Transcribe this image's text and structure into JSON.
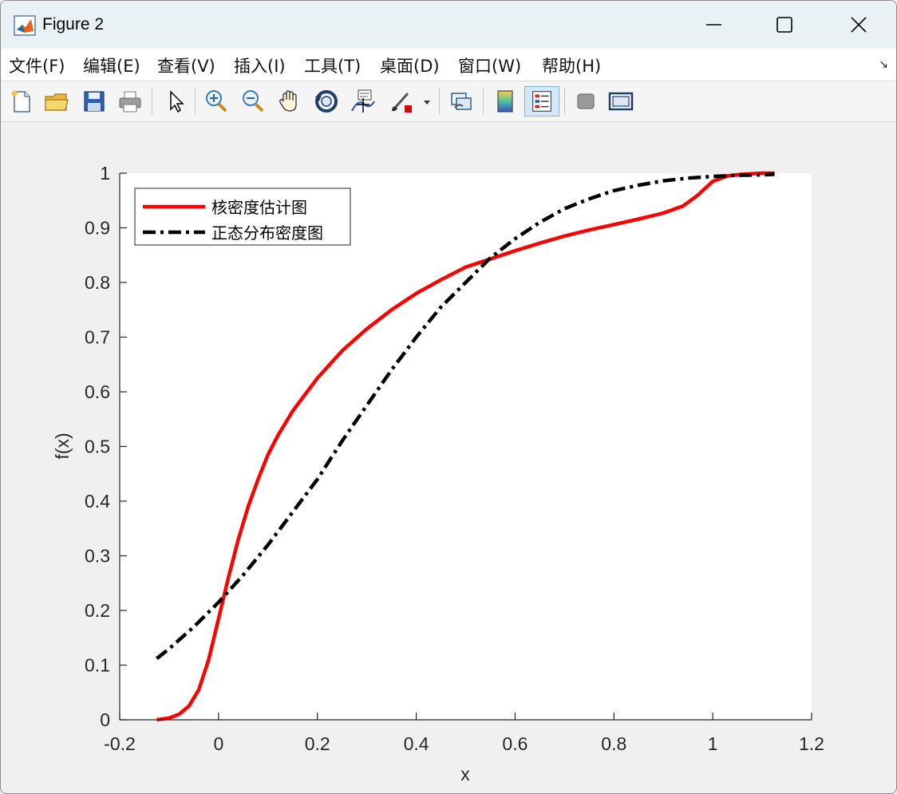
{
  "window": {
    "title": "Figure 2"
  },
  "menu": {
    "items": [
      "文件(F)",
      "编辑(E)",
      "查看(V)",
      "插入(I)",
      "工具(T)",
      "桌面(D)",
      "窗口(W)",
      "帮助(H)"
    ]
  },
  "toolbar": {
    "icons": [
      "new-file-icon",
      "open-folder-icon",
      "save-icon",
      "print-icon",
      "pointer-icon",
      "zoom-in-icon",
      "zoom-out-icon",
      "pan-hand-icon",
      "rotate-3d-icon",
      "data-cursor-icon",
      "brush-icon",
      "link-plot-icon",
      "colorbar-icon",
      "legend-icon",
      "hide-tools-icon",
      "dock-icon"
    ],
    "active": "legend-icon"
  },
  "chart_data": {
    "type": "line",
    "title": "",
    "xlabel": "x",
    "ylabel": "f(x)",
    "xlim": [
      -0.2,
      1.2
    ],
    "ylim": [
      0,
      1
    ],
    "xticks": [
      "-0.2",
      "0",
      "0.2",
      "0.4",
      "0.6",
      "0.8",
      "1",
      "1.2"
    ],
    "yticks": [
      "0",
      "0.1",
      "0.2",
      "0.3",
      "0.4",
      "0.5",
      "0.6",
      "0.7",
      "0.8",
      "0.9",
      "1"
    ],
    "grid": false,
    "legend_position": "top-left",
    "series": [
      {
        "name": "核密度估计图",
        "color": "#ff0000",
        "style": "solid",
        "x": [
          -0.125,
          -0.1,
          -0.08,
          -0.06,
          -0.04,
          -0.02,
          0.0,
          0.02,
          0.04,
          0.06,
          0.08,
          0.1,
          0.12,
          0.15,
          0.2,
          0.25,
          0.3,
          0.35,
          0.4,
          0.45,
          0.5,
          0.55,
          0.6,
          0.65,
          0.7,
          0.75,
          0.8,
          0.85,
          0.9,
          0.94,
          0.97,
          1.0,
          1.03,
          1.06,
          1.1,
          1.125
        ],
        "y": [
          0.0,
          0.003,
          0.01,
          0.025,
          0.055,
          0.11,
          0.185,
          0.26,
          0.33,
          0.39,
          0.44,
          0.485,
          0.52,
          0.565,
          0.625,
          0.675,
          0.715,
          0.75,
          0.78,
          0.805,
          0.828,
          0.843,
          0.858,
          0.872,
          0.885,
          0.896,
          0.906,
          0.916,
          0.927,
          0.94,
          0.96,
          0.985,
          0.995,
          0.998,
          1.0,
          1.0
        ]
      },
      {
        "name": "正态分布密度图",
        "color": "#000000",
        "style": "dashdot",
        "x": [
          -0.125,
          -0.1,
          -0.05,
          0.0,
          0.05,
          0.1,
          0.15,
          0.2,
          0.25,
          0.3,
          0.35,
          0.4,
          0.45,
          0.5,
          0.55,
          0.6,
          0.65,
          0.7,
          0.75,
          0.8,
          0.85,
          0.9,
          0.95,
          1.0,
          1.05,
          1.1,
          1.125
        ],
        "y": [
          0.112,
          0.13,
          0.17,
          0.215,
          0.265,
          0.32,
          0.38,
          0.44,
          0.51,
          0.575,
          0.64,
          0.7,
          0.755,
          0.8,
          0.845,
          0.88,
          0.91,
          0.935,
          0.953,
          0.968,
          0.978,
          0.986,
          0.991,
          0.994,
          0.996,
          0.997,
          0.998
        ]
      }
    ]
  }
}
